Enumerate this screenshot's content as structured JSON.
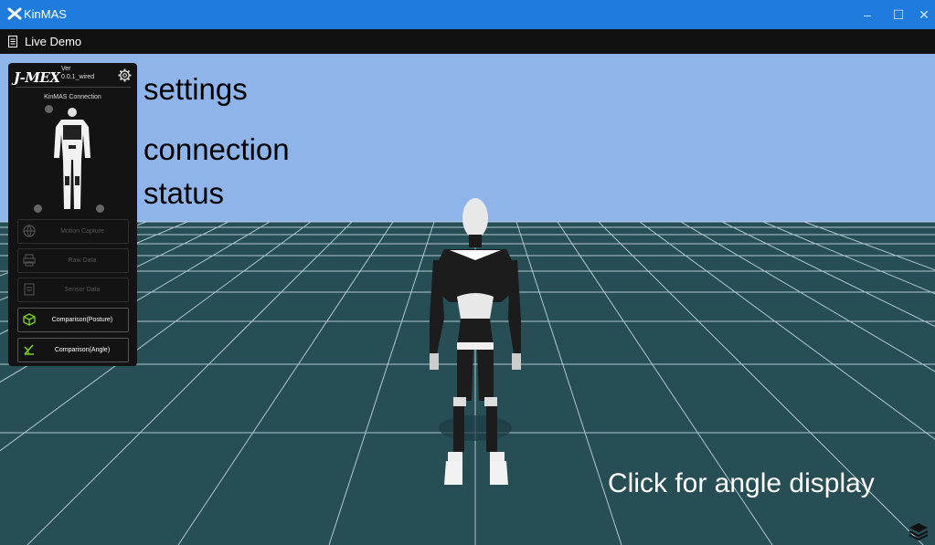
{
  "window": {
    "title": "KinMAS"
  },
  "menubar": {
    "label": "Live Demo"
  },
  "panel": {
    "brand": "J-MEX",
    "version_label": "Ver",
    "version_value": "0.0.1_wired",
    "connection_label": "KinMAS  Connection",
    "buttons": [
      {
        "label": "Motion Capture",
        "icon": "globe-icon",
        "enabled": false
      },
      {
        "label": "Raw Data",
        "icon": "printer-icon",
        "enabled": false
      },
      {
        "label": "Sensor Data",
        "icon": "document-icon",
        "enabled": false
      },
      {
        "label": "Comparison(Posture)",
        "icon": "cube-icon",
        "enabled": true
      },
      {
        "label": "Comparison(Angle)",
        "icon": "angle-icon",
        "enabled": true
      }
    ]
  },
  "annotations": {
    "settings": "settings",
    "connection": "connection",
    "status": "status",
    "angle": "Click for angle display"
  },
  "colors": {
    "titlebar": "#1f7bdc",
    "sky": "#8fb4ea",
    "floor": "#274e55",
    "grid": "#c9dde6",
    "accent_green": "#7ed321"
  }
}
